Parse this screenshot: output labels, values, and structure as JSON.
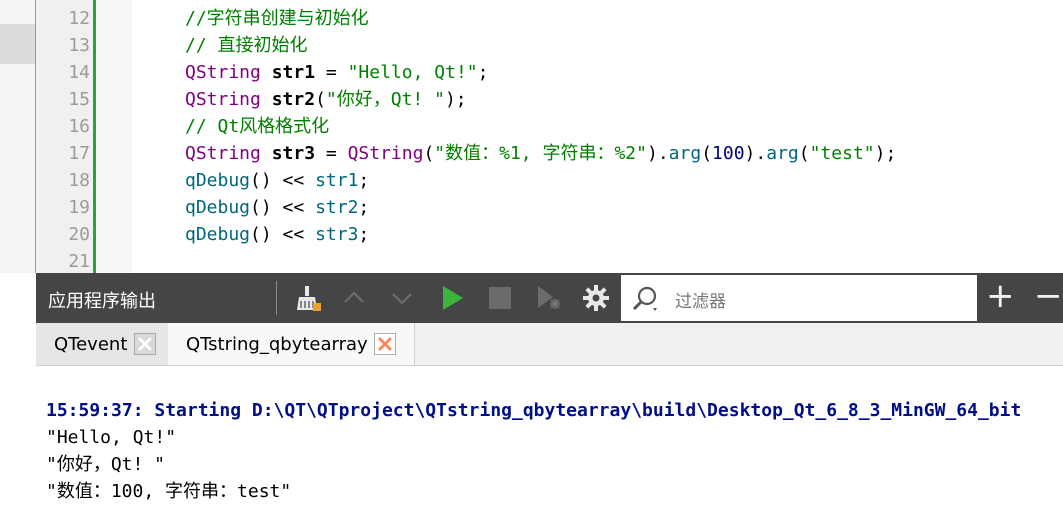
{
  "editor": {
    "lines": [
      {
        "num": "12",
        "parts": [
          {
            "t": "//字符串创建与初始化",
            "c": "cmt"
          }
        ]
      },
      {
        "num": "13",
        "parts": [
          {
            "t": "// 直接初始化",
            "c": "cmt"
          }
        ]
      },
      {
        "num": "14",
        "parts": [
          {
            "t": "QString ",
            "c": "type"
          },
          {
            "t": "str1",
            "c": "var"
          },
          {
            "t": " = ",
            "c": "op"
          },
          {
            "t": "\"Hello, Qt!\"",
            "c": "str"
          },
          {
            "t": ";",
            "c": "op"
          }
        ]
      },
      {
        "num": "15",
        "parts": [
          {
            "t": "QString ",
            "c": "type"
          },
          {
            "t": "str2",
            "c": "var"
          },
          {
            "t": "(",
            "c": "op"
          },
          {
            "t": "\"你好，Qt! \"",
            "c": "str"
          },
          {
            "t": ");",
            "c": "op"
          }
        ]
      },
      {
        "num": "16",
        "parts": [
          {
            "t": "// Qt风格格式化",
            "c": "cmt"
          }
        ]
      },
      {
        "num": "17",
        "parts": [
          {
            "t": "QString ",
            "c": "type"
          },
          {
            "t": "str3",
            "c": "var"
          },
          {
            "t": " = ",
            "c": "op"
          },
          {
            "t": "QString",
            "c": "type"
          },
          {
            "t": "(",
            "c": "op"
          },
          {
            "t": "\"数值：%1, 字符串：%2\"",
            "c": "str"
          },
          {
            "t": ").",
            "c": "op"
          },
          {
            "t": "arg",
            "c": "fn"
          },
          {
            "t": "(",
            "c": "op"
          },
          {
            "t": "100",
            "c": "num"
          },
          {
            "t": ").",
            "c": "op"
          },
          {
            "t": "arg",
            "c": "fn"
          },
          {
            "t": "(",
            "c": "op"
          },
          {
            "t": "\"test\"",
            "c": "str"
          },
          {
            "t": ");",
            "c": "op"
          }
        ]
      },
      {
        "num": "18",
        "parts": [
          {
            "t": "qDebug",
            "c": "fn"
          },
          {
            "t": "() << ",
            "c": "op"
          },
          {
            "t": "str1",
            "c": "fn"
          },
          {
            "t": ";",
            "c": "op"
          }
        ]
      },
      {
        "num": "19",
        "parts": [
          {
            "t": "qDebug",
            "c": "fn"
          },
          {
            "t": "() << ",
            "c": "op"
          },
          {
            "t": "str2",
            "c": "fn"
          },
          {
            "t": ";",
            "c": "op"
          }
        ]
      },
      {
        "num": "20",
        "parts": [
          {
            "t": "qDebug",
            "c": "fn"
          },
          {
            "t": "() << ",
            "c": "op"
          },
          {
            "t": "str3",
            "c": "fn"
          },
          {
            "t": ";",
            "c": "op"
          }
        ]
      },
      {
        "num": "21",
        "parts": []
      }
    ]
  },
  "output_pane": {
    "title": "应用程序输出",
    "toolbar_icons": [
      "clean-output-icon",
      "previous-up-icon",
      "next-down-icon",
      "run-icon",
      "stop-icon",
      "debug-icon",
      "settings-gear-icon"
    ],
    "filter_placeholder": "过滤器",
    "add_label": "+",
    "remove_label": "−",
    "colors": {
      "toolbar_bg": "#454545",
      "run_green": "#3cb43c",
      "close_orange": "#ff7f50"
    }
  },
  "tabs": [
    {
      "label": "QTevent",
      "active": false
    },
    {
      "label": "QTstring_qbytearray",
      "active": true
    }
  ],
  "output": {
    "lines": [
      {
        "text": "15:59:37: Starting D:\\QT\\QTproject\\QTstring_qbytearray\\build\\Desktop_Qt_6_8_3_MinGW_64_bit",
        "style": "blue"
      },
      {
        "text": "\"Hello, Qt!\"",
        "style": "normal"
      },
      {
        "text": "\"你好，Qt! \"",
        "style": "normal"
      },
      {
        "text": "\"数值：100, 字符串：test\"",
        "style": "normal"
      }
    ]
  }
}
